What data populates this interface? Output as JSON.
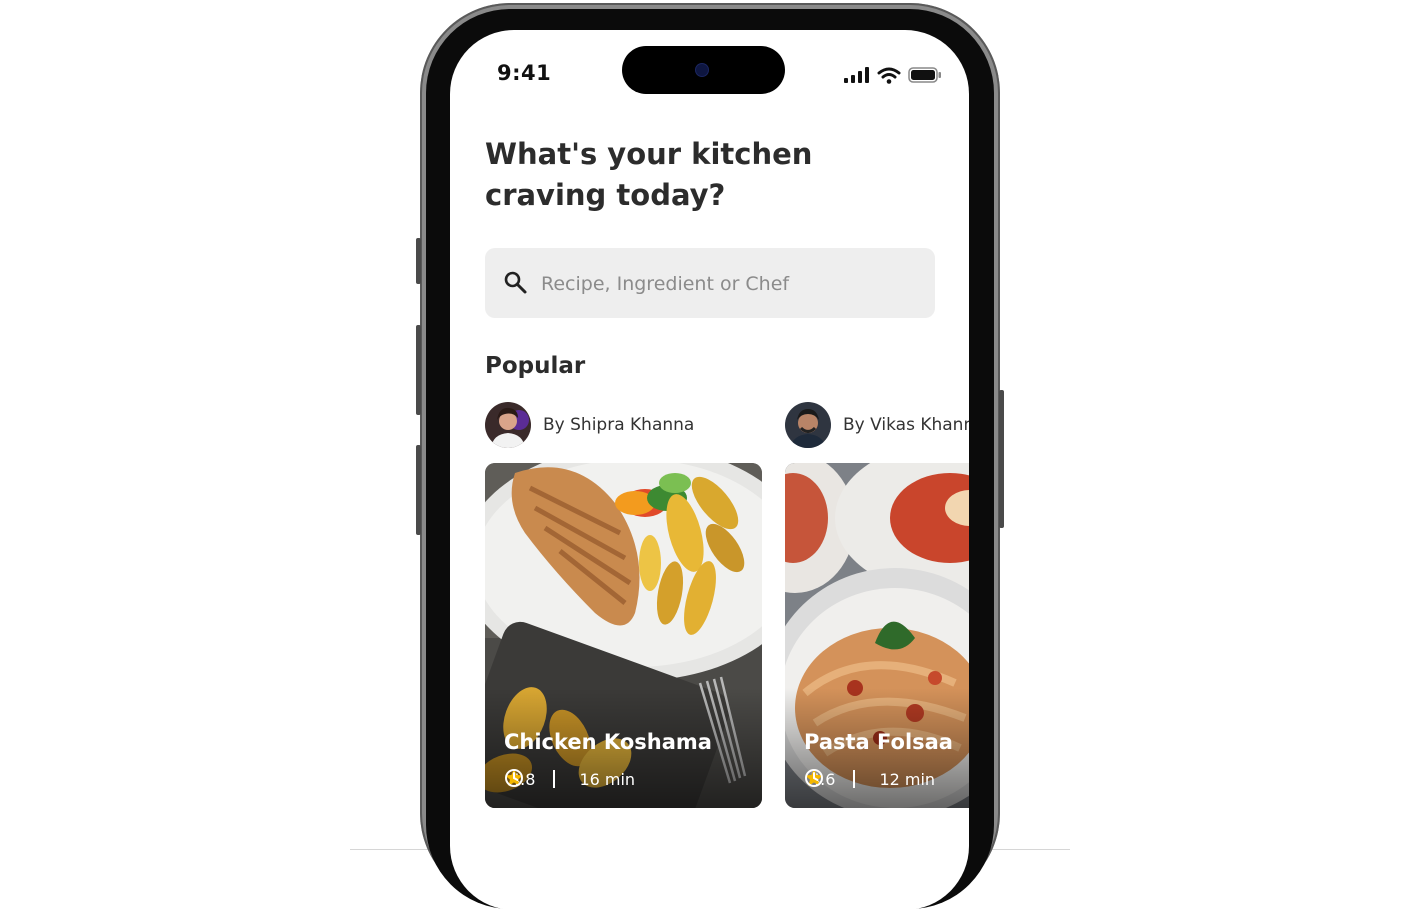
{
  "status_bar": {
    "time": "9:41"
  },
  "headline": "What's your kitchen craving today?",
  "search": {
    "placeholder": "Recipe, Ingredient or Chef",
    "value": ""
  },
  "popular": {
    "title": "Popular",
    "cards": [
      {
        "author": "By Shipra Khanna",
        "recipe": "Chicken Koshama",
        "rating": "4.8",
        "time": "16 min"
      },
      {
        "author": "By Vikas Khanna",
        "recipe": "Pasta Folsaa",
        "rating": "4.6",
        "time": "12 min"
      }
    ]
  },
  "icons": {
    "search": "search-icon",
    "star": "star-icon",
    "clock": "clock-icon",
    "signal": "cellular-signal-icon",
    "wifi": "wifi-icon",
    "battery": "battery-icon"
  },
  "colors": {
    "star": "#f5b800",
    "search_bg": "#eeeeee",
    "text": "#2c2c2c"
  }
}
